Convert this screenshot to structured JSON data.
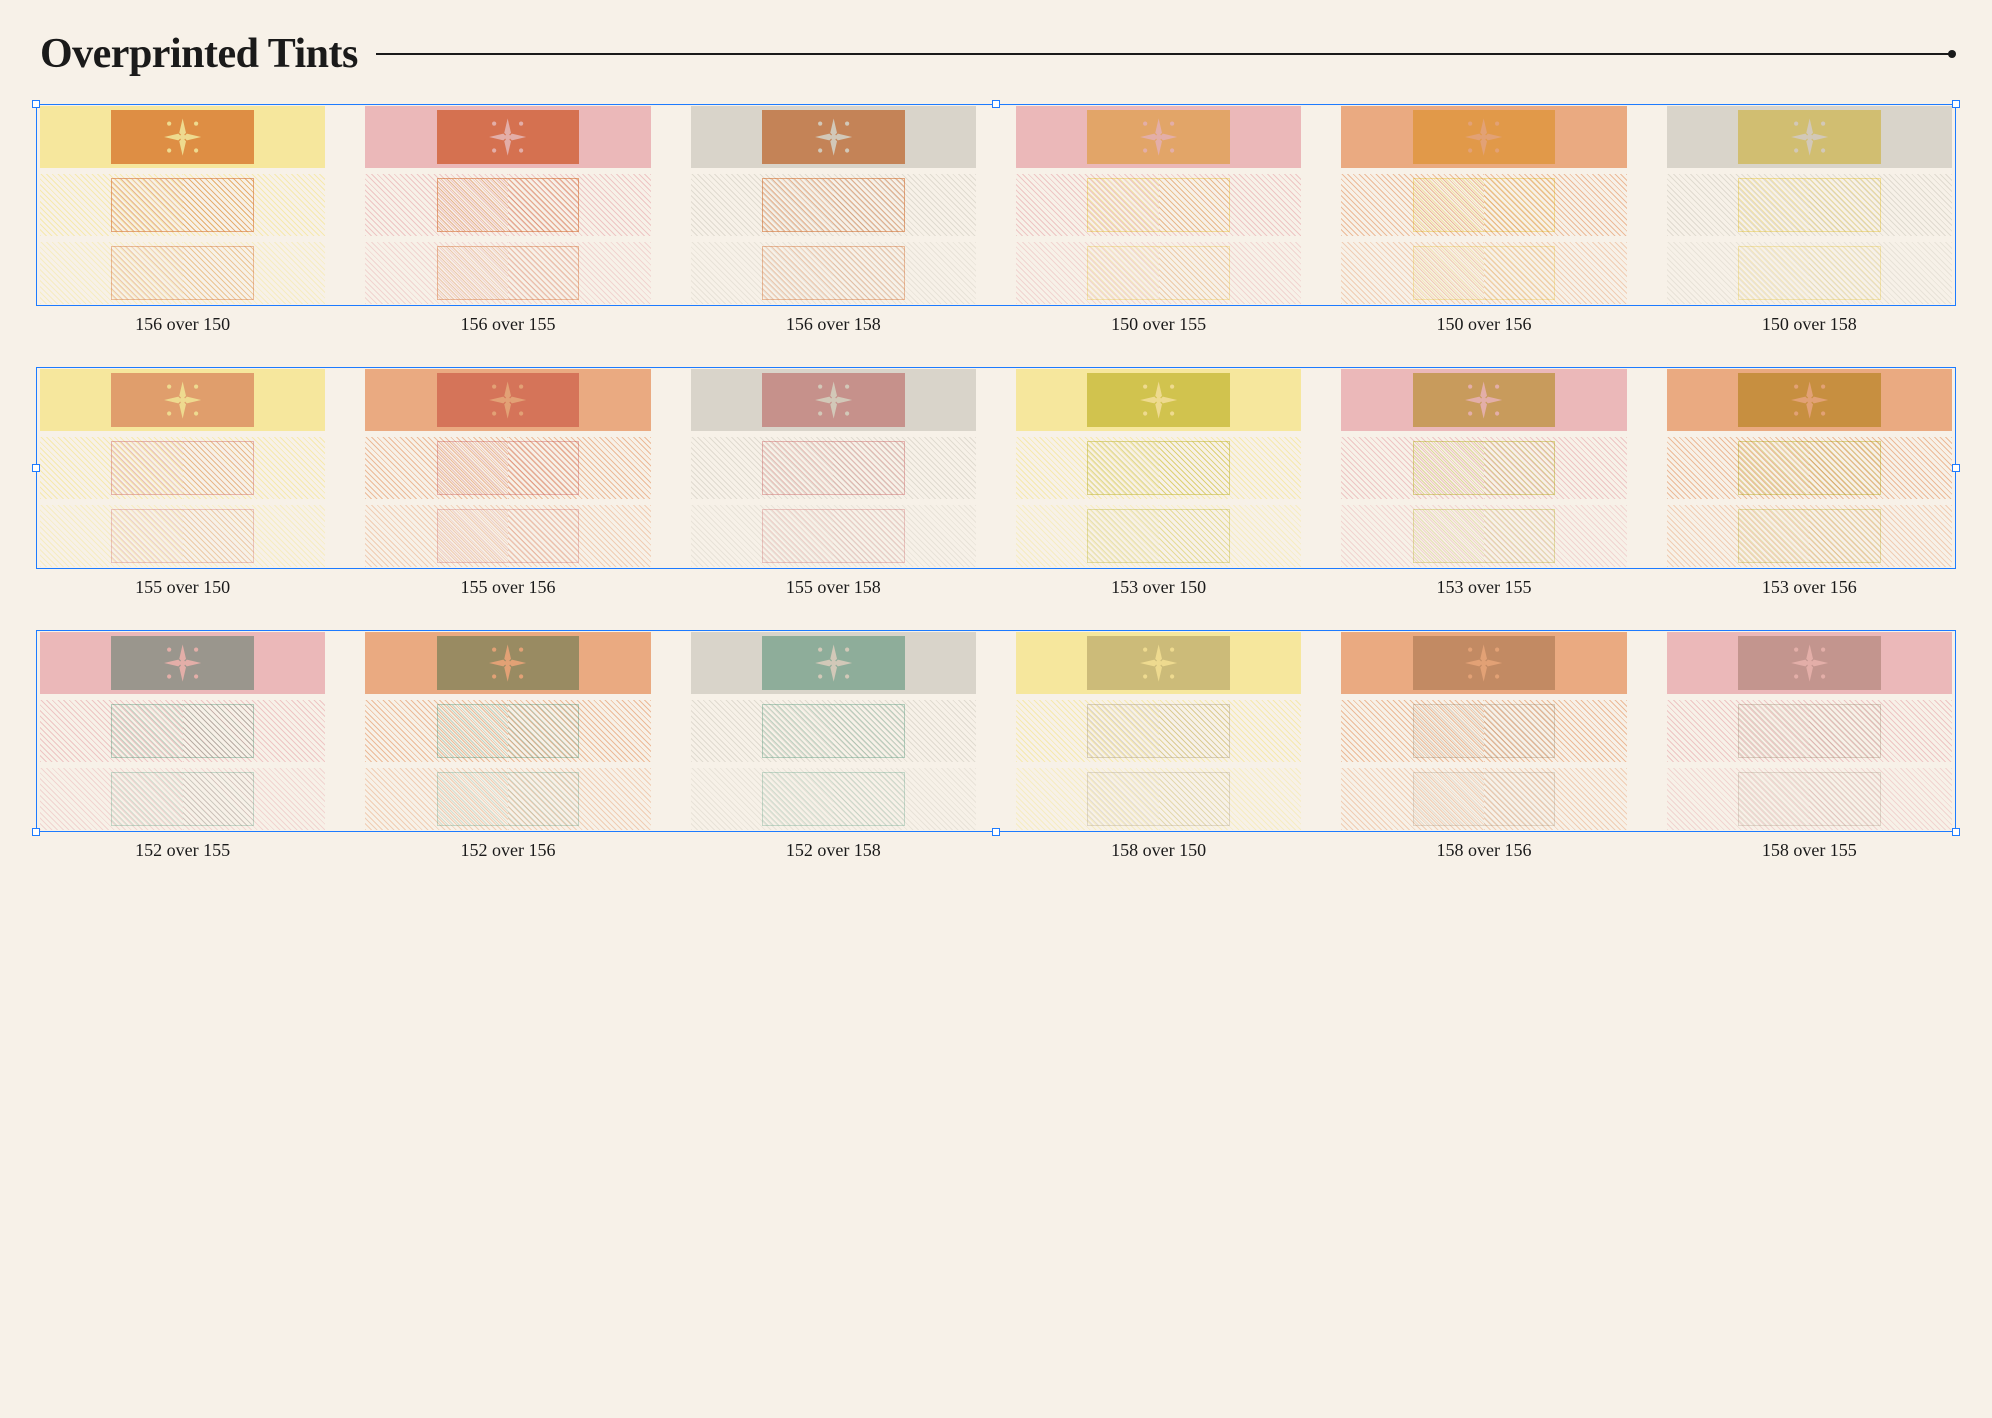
{
  "title": "Overprinted Tints",
  "ink_colors": {
    "150": "#f6e58f",
    "152": "#a7d0c2",
    "153": "#d9d77e",
    "155": "#e9aeb0",
    "156": "#e79d6e",
    "158": "#d4cfc4"
  },
  "swatches": [
    {
      "over": "156",
      "under": "150",
      "label": "156 over 150"
    },
    {
      "over": "156",
      "under": "155",
      "label": "156 over 155"
    },
    {
      "over": "156",
      "under": "158",
      "label": "156 over 158"
    },
    {
      "over": "150",
      "under": "155",
      "label": "150 over 155"
    },
    {
      "over": "150",
      "under": "156",
      "label": "150 over 156"
    },
    {
      "over": "150",
      "under": "158",
      "label": "150 over 158"
    },
    {
      "over": "155",
      "under": "150",
      "label": "155 over 150"
    },
    {
      "over": "155",
      "under": "156",
      "label": "155 over 156"
    },
    {
      "over": "155",
      "under": "158",
      "label": "155 over 158"
    },
    {
      "over": "153",
      "under": "150",
      "label": "153 over 150"
    },
    {
      "over": "153",
      "under": "155",
      "label": "153 over 155"
    },
    {
      "over": "153",
      "under": "156",
      "label": "153 over 156"
    },
    {
      "over": "152",
      "under": "155",
      "label": "152 over 155"
    },
    {
      "over": "152",
      "under": "156",
      "label": "152 over 156"
    },
    {
      "over": "152",
      "under": "158",
      "label": "152 over 158"
    },
    {
      "over": "158",
      "under": "150",
      "label": "158 over 150"
    },
    {
      "over": "158",
      "under": "156",
      "label": "158 over 156"
    },
    {
      "over": "158",
      "under": "155",
      "label": "158 over 155"
    }
  ],
  "selection": {
    "rows": 3,
    "cols": 6,
    "color": "#1d7bff"
  }
}
